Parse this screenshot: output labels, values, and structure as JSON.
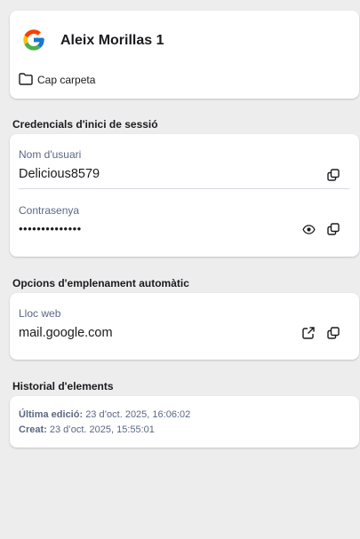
{
  "header": {
    "item_name": "Aleix Morillas 1",
    "folder_label": "Cap carpeta",
    "logo_icon": "google-logo",
    "folder_icon": "folder-icon"
  },
  "credentials": {
    "section_title": "Credencials d'inici de sessió",
    "username_label": "Nom d'usuari",
    "username_value": "Delicious8579",
    "password_label": "Contrasenya",
    "password_value": "••••••••••••••"
  },
  "autofill": {
    "section_title": "Opcions d'emplenament automàtic",
    "website_label": "Lloc web",
    "website_value": "mail.google.com"
  },
  "history": {
    "section_title": "Historial d'elements",
    "last_edited_label": "Última edició:",
    "last_edited_value": "23 d’oct. 2025, 16:06:02",
    "created_label": "Creat:",
    "created_value": "23 d’oct. 2025, 15:55:01"
  },
  "colors": {
    "background": "#ededee",
    "card": "#ffffff",
    "label": "#5a6784",
    "text": "#1b1b1f"
  }
}
